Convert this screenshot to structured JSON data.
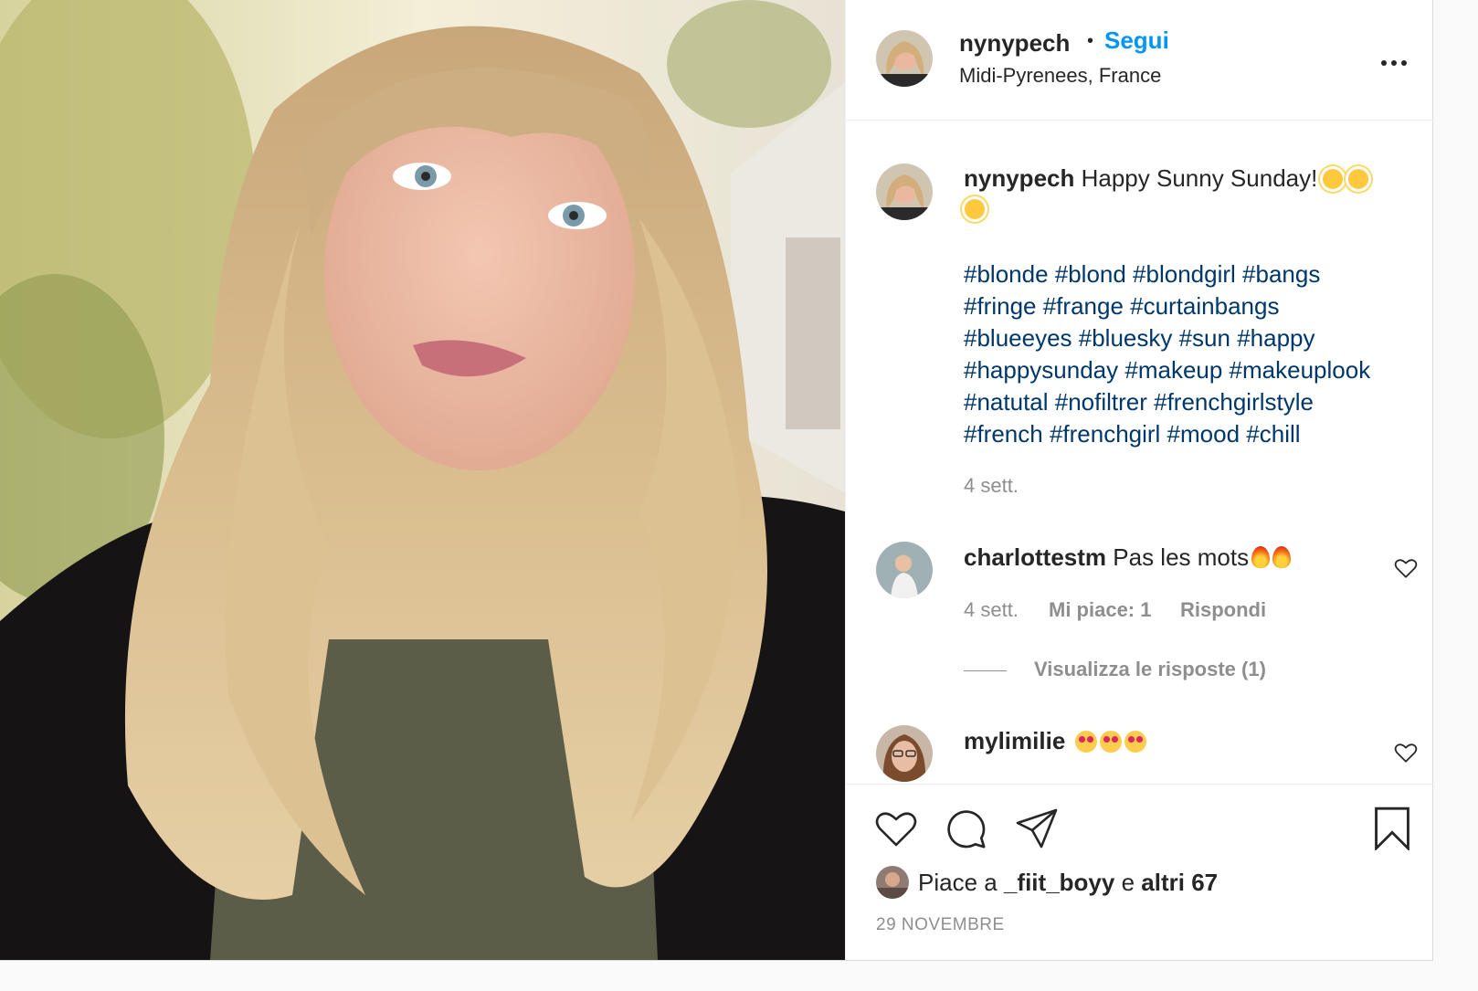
{
  "post": {
    "username": "nynypech",
    "dot": "•",
    "follow_label": "Segui",
    "location": "Midi-Pyrenees, France",
    "more_icon": "more-options-icon"
  },
  "caption": {
    "username": "nynypech",
    "text": "Happy Sunny Sunday!",
    "emoji": "sun-emoji",
    "hashtag_lines": [
      "#blonde #blond #blondgirl #bangs",
      "#fringe #frange #curtainbangs",
      "#blueeyes #bluesky #sun #happy",
      "#happysunday #makeup #makeuplook",
      "#natutal #nofiltrer #frenchgirlstyle",
      "#french #frenchgirl #mood #chill"
    ],
    "time": "4 sett."
  },
  "comments": [
    {
      "username": "charlottestm",
      "text": "Pas les mots",
      "emoji": "fire-emoji",
      "time": "4 sett.",
      "likes": "Mi piace: 1",
      "reply_label": "Rispondi",
      "view_replies": "Visualizza le risposte (1)"
    },
    {
      "username": "mylimilie",
      "text": "",
      "emoji": "heart-eyes-emoji"
    }
  ],
  "actions": {
    "likes_prefix": "Piace a",
    "liked_by": "_fiit_boyy",
    "likes_connector": "e",
    "likes_others": "altri 67",
    "date": "29 NOVEMBRE"
  },
  "colors": {
    "link_blue": "#0095f6",
    "hashtag": "#00376b",
    "secondary": "#8e8e8e",
    "primary": "#262626"
  }
}
